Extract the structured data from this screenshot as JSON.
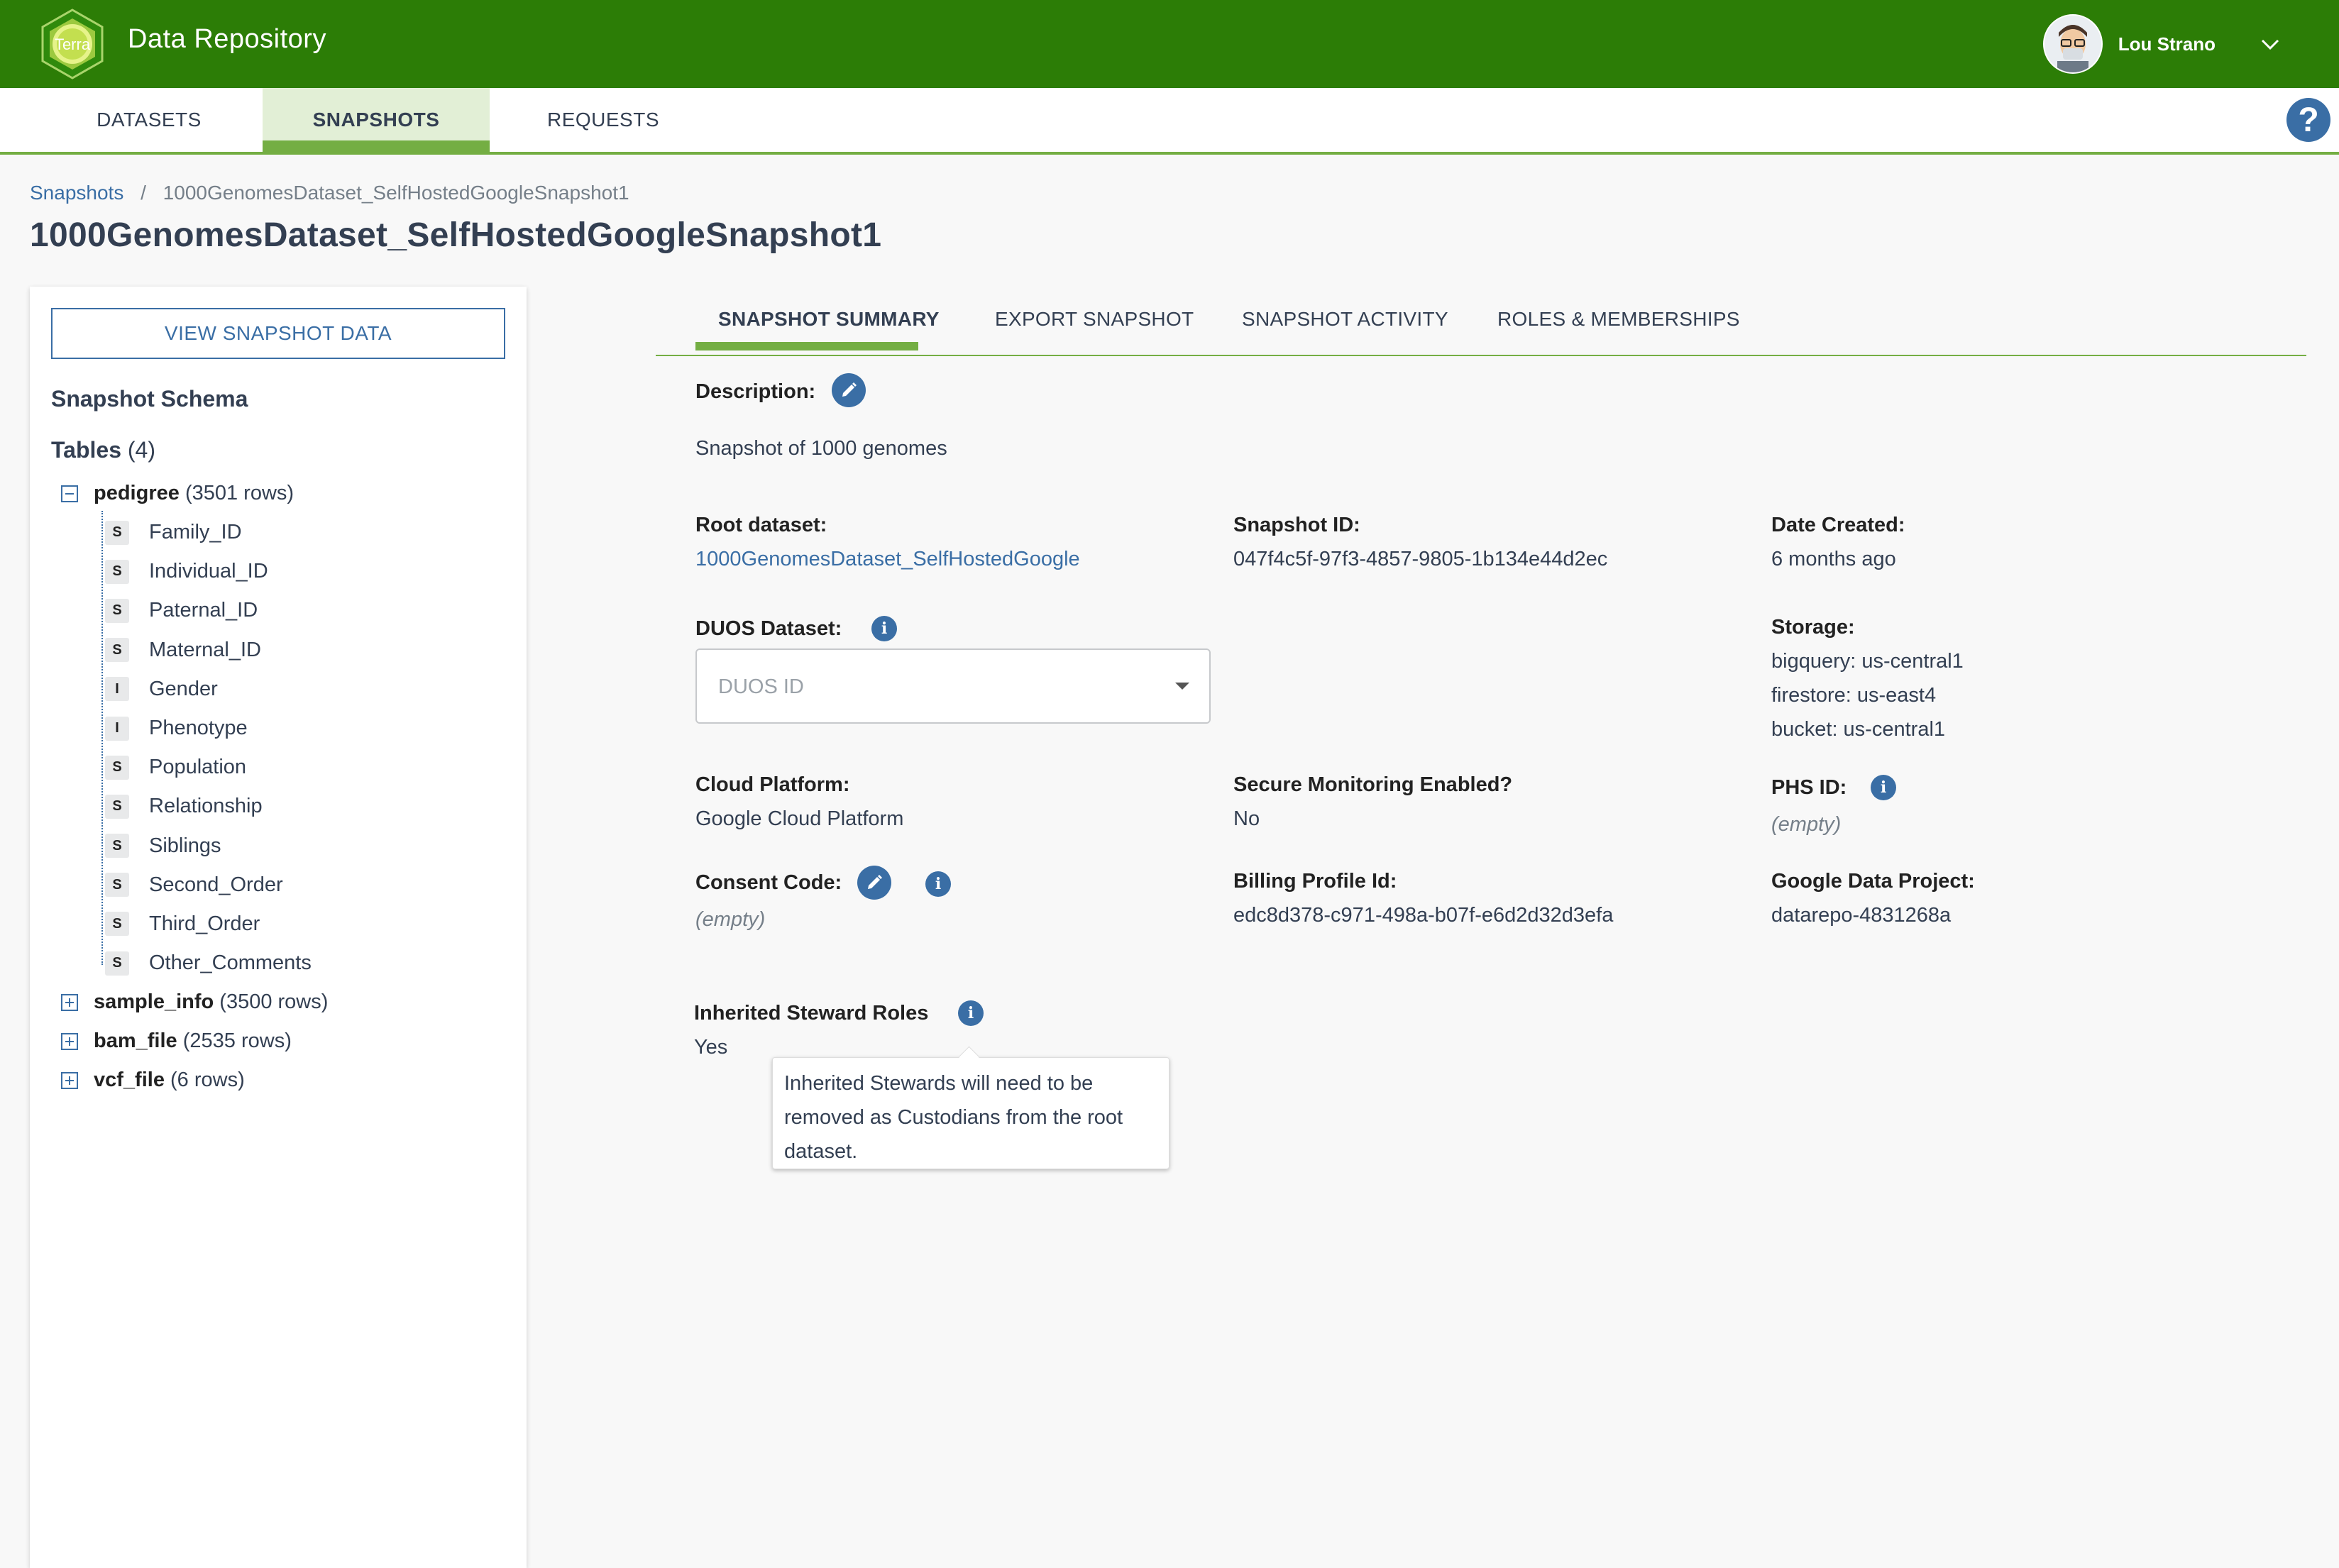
{
  "app": {
    "logo_text": "Terra",
    "title": "Data Repository"
  },
  "user": {
    "name": "Lou Strano"
  },
  "nav": {
    "tabs": [
      "DATASETS",
      "SNAPSHOTS",
      "REQUESTS"
    ],
    "active": "SNAPSHOTS",
    "help_label": "?"
  },
  "breadcrumb": {
    "root": "Snapshots",
    "separator": "/",
    "current": "1000GenomesDataset_SelfHostedGoogleSnapshot1"
  },
  "page_title": "1000GenomesDataset_SelfHostedGoogleSnapshot1",
  "left_panel": {
    "view_button": "VIEW SNAPSHOT DATA",
    "schema_title": "Snapshot Schema",
    "tables_label": "Tables",
    "tables_count": "(4)",
    "tables": [
      {
        "name": "pedigree",
        "rows": "(3501 rows)",
        "expanded": true,
        "columns": [
          {
            "type": "S",
            "name": "Family_ID"
          },
          {
            "type": "S",
            "name": "Individual_ID"
          },
          {
            "type": "S",
            "name": "Paternal_ID"
          },
          {
            "type": "S",
            "name": "Maternal_ID"
          },
          {
            "type": "I",
            "name": "Gender"
          },
          {
            "type": "I",
            "name": "Phenotype"
          },
          {
            "type": "S",
            "name": "Population"
          },
          {
            "type": "S",
            "name": "Relationship"
          },
          {
            "type": "S",
            "name": "Siblings"
          },
          {
            "type": "S",
            "name": "Second_Order"
          },
          {
            "type": "S",
            "name": "Third_Order"
          },
          {
            "type": "S",
            "name": "Other_Comments"
          }
        ]
      },
      {
        "name": "sample_info",
        "rows": "(3500 rows)",
        "expanded": false
      },
      {
        "name": "bam_file",
        "rows": "(2535 rows)",
        "expanded": false
      },
      {
        "name": "vcf_file",
        "rows": "(6 rows)",
        "expanded": false
      }
    ]
  },
  "content_tabs": [
    "SNAPSHOT SUMMARY",
    "EXPORT SNAPSHOT",
    "SNAPSHOT ACTIVITY",
    "ROLES & MEMBERSHIPS"
  ],
  "summary": {
    "description_label": "Description:",
    "description": "Snapshot of 1000 genomes",
    "root_dataset_label": "Root dataset:",
    "root_dataset": "1000GenomesDataset_SelfHostedGoogle",
    "snapshot_id_label": "Snapshot ID:",
    "snapshot_id": "047f4c5f-97f3-4857-9805-1b134e44d2ec",
    "date_created_label": "Date Created:",
    "date_created": "6 months ago",
    "duos_label": "DUOS Dataset:",
    "duos_placeholder": "DUOS ID",
    "storage_label": "Storage:",
    "storage": [
      "bigquery: us-central1",
      "firestore: us-east4",
      "bucket: us-central1"
    ],
    "cloud_platform_label": "Cloud Platform:",
    "cloud_platform": "Google Cloud Platform",
    "secure_monitoring_label": "Secure Monitoring Enabled?",
    "secure_monitoring": "No",
    "phs_label": "PHS ID:",
    "phs": "(empty)",
    "consent_label": "Consent Code:",
    "consent": "(empty)",
    "billing_label": "Billing Profile Id:",
    "billing": "edc8d378-c971-498a-b07f-e6d2d32d3efa",
    "gdp_label": "Google Data Project:",
    "gdp": "datarepo-4831268a",
    "inherited_label": "Inherited Steward Roles",
    "inherited": "Yes",
    "tooltip": "Inherited Stewards will need to be removed as Custodians from the root dataset."
  },
  "colors": {
    "header_green": "#2c7d06",
    "accent_green": "#74ae43",
    "link_blue": "#3a6ea5"
  }
}
